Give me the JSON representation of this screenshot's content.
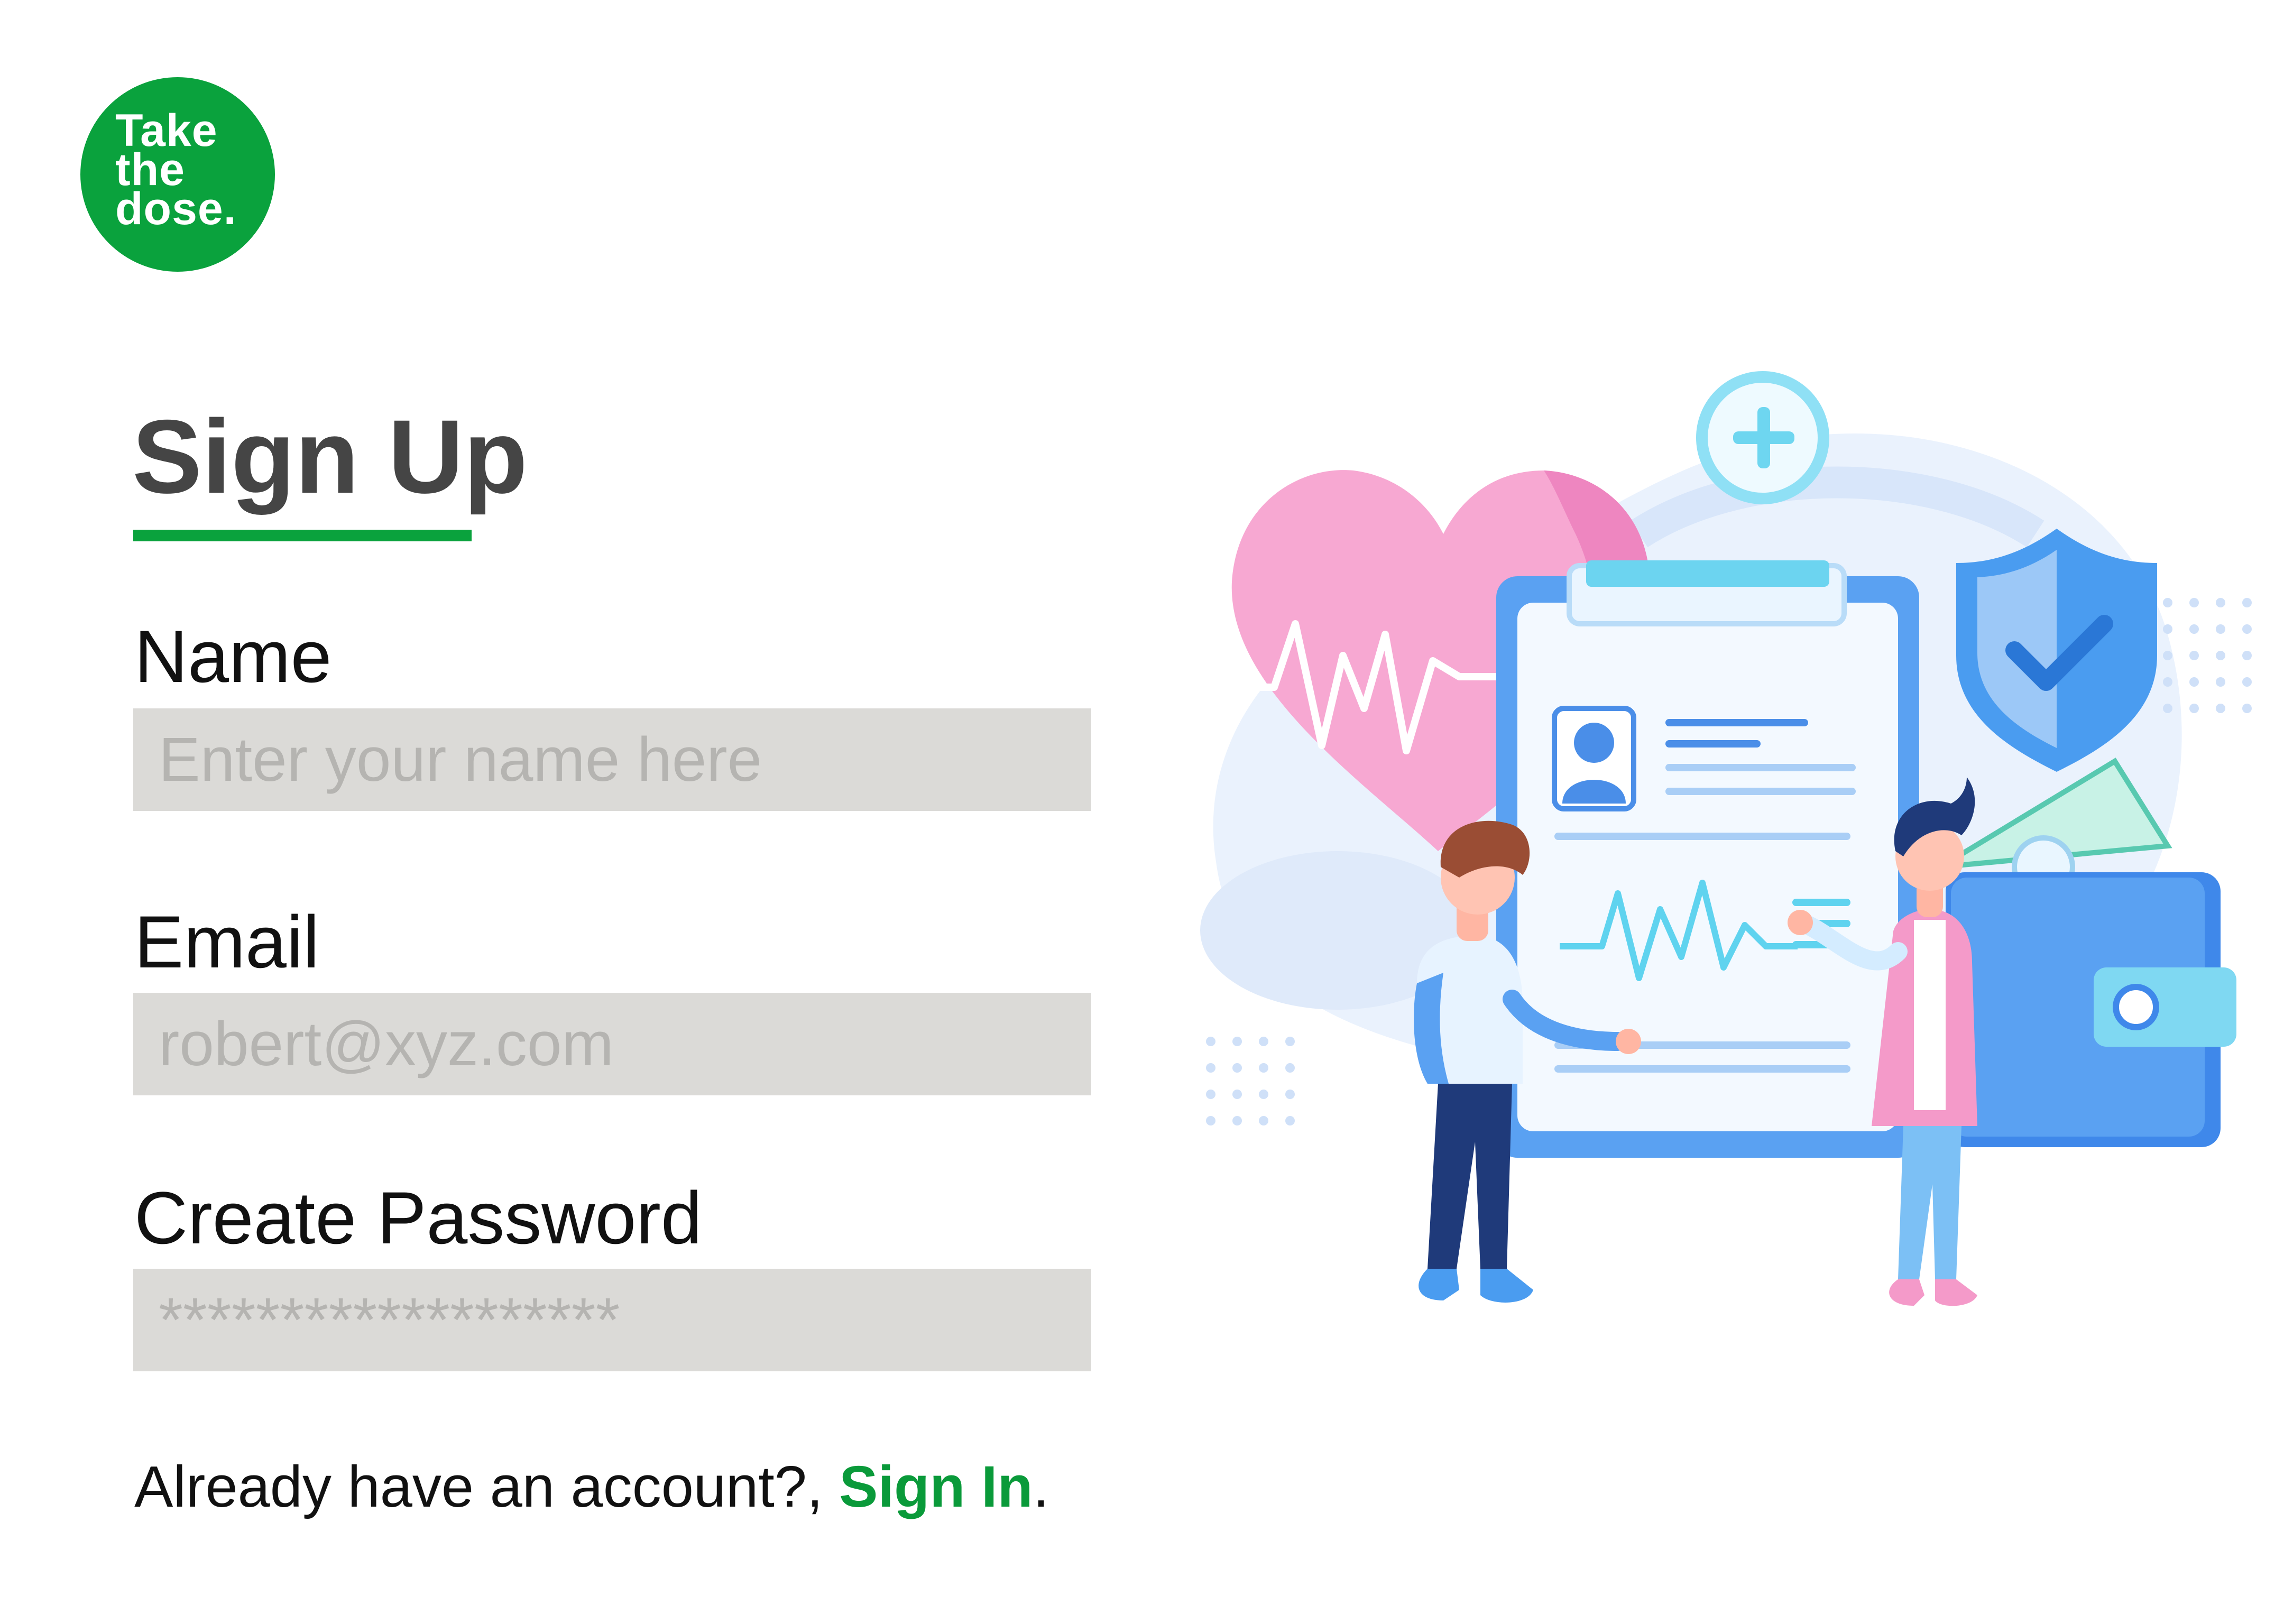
{
  "logo": {
    "lines": [
      "Take",
      "the",
      "dose."
    ],
    "color": "#0aa23d"
  },
  "page": {
    "title": "Sign Up",
    "accent_color": "#0aa23d"
  },
  "form": {
    "name": {
      "label": "Name",
      "placeholder": "Enter your name here"
    },
    "email": {
      "label": "Email",
      "placeholder": "robert@xyz.com"
    },
    "password": {
      "label": "Create Password",
      "placeholder": "*******************"
    }
  },
  "footer": {
    "prompt": "Already have an account?, ",
    "link_label": "Sign In",
    "suffix": "."
  },
  "illustration": {
    "icons": [
      "heart-icon",
      "plus-icon",
      "shield-check-icon",
      "clipboard-icon",
      "wallet-icon",
      "heartbeat-icon",
      "user-profile-icon"
    ],
    "colors": {
      "heart": "#f49ac9",
      "blue": "#4a9cf0",
      "light_blue": "#dbe9fb",
      "cyan": "#5fd3ef"
    }
  }
}
